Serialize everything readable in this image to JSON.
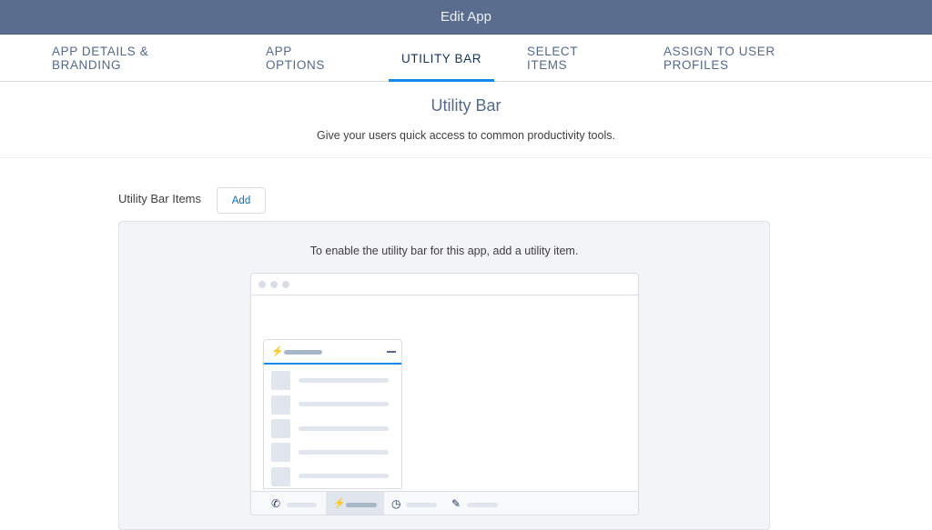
{
  "header": {
    "title": "Edit App"
  },
  "tabs": [
    {
      "label": "APP DETAILS & BRANDING",
      "active": false
    },
    {
      "label": "APP OPTIONS",
      "active": false
    },
    {
      "label": "UTILITY BAR",
      "active": true
    },
    {
      "label": "SELECT ITEMS",
      "active": false
    },
    {
      "label": "ASSIGN TO USER PROFILES",
      "active": false
    }
  ],
  "section": {
    "title": "Utility Bar",
    "subtitle": "Give your users quick access to common productivity tools."
  },
  "utility_items": {
    "label": "Utility Bar Items",
    "add_label": "Add",
    "empty_message": "To enable the utility bar for this app, add a utility item."
  },
  "illustration": {
    "panel_icon": "lightning-icon",
    "utility_bar_icons": [
      "phone-icon",
      "lightning-icon",
      "clock-icon",
      "notes-icon"
    ],
    "active_utility_index": 1
  },
  "colors": {
    "header_bg": "#5a6d8e",
    "active_tab_underline": "#1589ee",
    "link_blue": "#0070d2"
  }
}
